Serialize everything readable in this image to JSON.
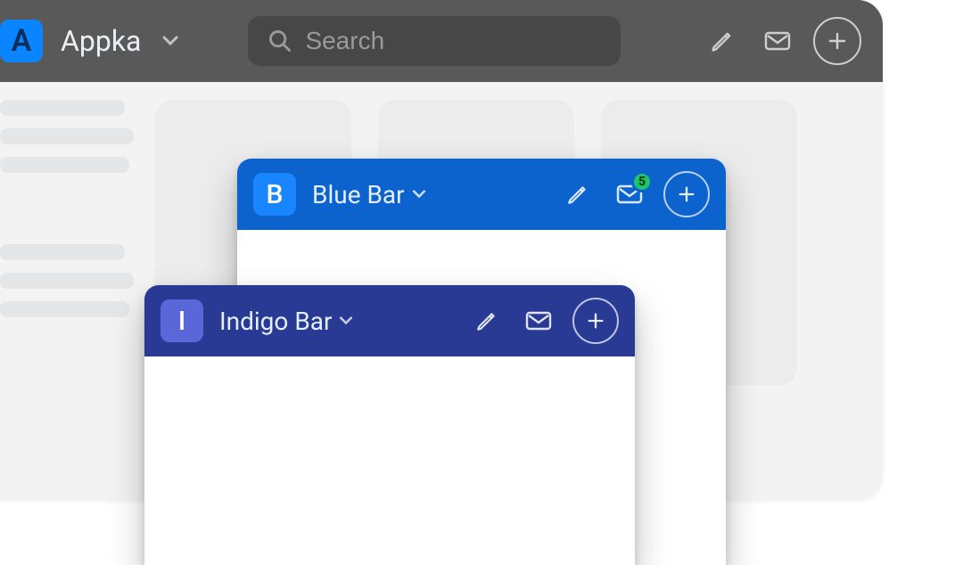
{
  "main": {
    "avatar_letter": "A",
    "title": "Appka",
    "search_placeholder": "Search"
  },
  "blue": {
    "avatar_letter": "B",
    "title": "Blue Bar",
    "mail_badge": "5"
  },
  "indigo": {
    "avatar_letter": "I",
    "title": "Indigo Bar"
  },
  "colors": {
    "topbar": "#595959",
    "blue_bar": "#0d63ce",
    "indigo_bar": "#283a94",
    "badge": "#20c36a"
  }
}
